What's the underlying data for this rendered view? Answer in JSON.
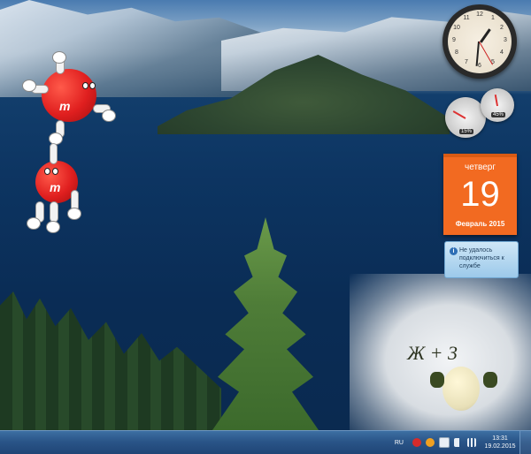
{
  "desktop": {
    "gadgets": {
      "clock": {
        "numbers": [
          "12",
          "1",
          "2",
          "3",
          "4",
          "5",
          "6",
          "7",
          "8",
          "9",
          "10",
          "11"
        ]
      },
      "cpu_meter": {
        "cpu": "15%",
        "memory": "45%"
      },
      "calendar": {
        "weekday": "четверг",
        "day": "19",
        "month_year": "Февраль 2015"
      },
      "notice": {
        "text": "Не удалось подключиться к службе",
        "icon": "info-icon"
      }
    },
    "mascot_text": "Ж + 3"
  },
  "taskbar": {
    "language": "RU",
    "tray_icons": [
      "record-icon",
      "media-icon",
      "flag-icon",
      "volume-icon",
      "network-icon"
    ],
    "time": "13:31",
    "date": "19.02.2015",
    "colors": {
      "record": "#d62b2b",
      "media": "#f0a020",
      "flag": "#ffffff",
      "volume": "#e8eef5",
      "network": "#e8eef5"
    }
  }
}
